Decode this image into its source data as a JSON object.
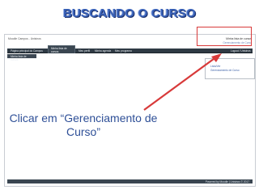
{
  "slide": {
    "title": "BUSCANDO O CURSO",
    "callout": "Clicar em “Gerenciamento de Curso”"
  },
  "app": {
    "top_left": "Moodle Campus - Unisinos",
    "top_right": "Minha lista de cursos",
    "sub_right": "Gerenciamento de Curso",
    "menu": {
      "home": "Página principal do Campus",
      "active_tab": "Minha lista de cursos",
      "profile": "Meu perfil",
      "calendar": "Minha agenda",
      "programs": "Meu programa",
      "logout": "Logout / Unisinos"
    },
    "submenu_label": "Minha lista de cursos",
    "dropdown": {
      "option1": "Lista/Ver",
      "option2": "Gerenciamento de Curso"
    },
    "footer": "Powered by Moodle | Unisinos © 2017"
  },
  "colors": {
    "title": "#3a62b8",
    "menubar": "#2f3a44",
    "highlight": "#d83a3a",
    "callout": "#2e4f97"
  }
}
